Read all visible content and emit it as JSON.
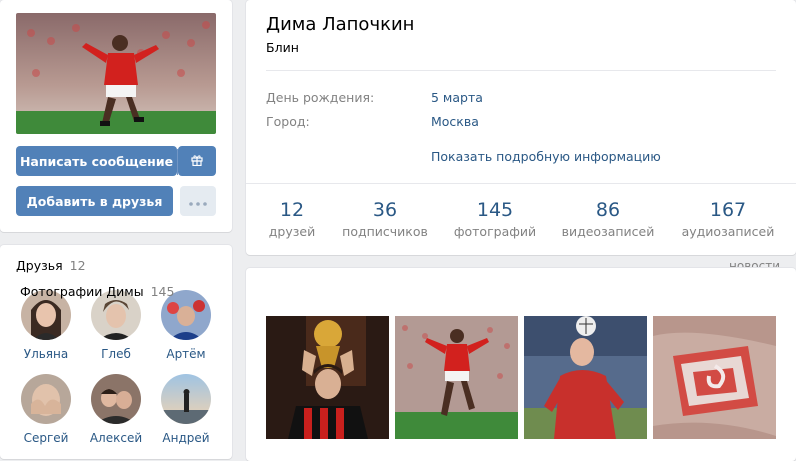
{
  "sidebar": {
    "message_button": "Написать сообщение",
    "gift_icon": "gift-icon",
    "add_friend_button": "Добавить в друзья",
    "more_icon": "more-dots-icon"
  },
  "friends": {
    "title": "Друзья",
    "count": "12",
    "news_link": "новости",
    "items": [
      {
        "name": "Ульяна"
      },
      {
        "name": "Глеб"
      },
      {
        "name": "Артём"
      },
      {
        "name": "Сергей"
      },
      {
        "name": "Алексей"
      },
      {
        "name": "Андрей"
      }
    ]
  },
  "profile": {
    "name": "Дима Лапочкин",
    "status": "Блин",
    "info": [
      {
        "label": "День рождения:",
        "value": "5 марта"
      },
      {
        "label": "Город:",
        "value": "Москва"
      }
    ],
    "more_link": "Показать подробную информацию",
    "counters": [
      {
        "num": "12",
        "label": "друзей"
      },
      {
        "num": "36",
        "label": "подписчиков"
      },
      {
        "num": "145",
        "label": "фотографий"
      },
      {
        "num": "86",
        "label": "видеозаписей"
      },
      {
        "num": "167",
        "label": "аудиозаписей"
      }
    ]
  },
  "photos": {
    "title": "Фотографии Димы",
    "count": "145"
  },
  "colors": {
    "accent": "#5181b8",
    "link": "#2a5885",
    "muted": "#828282",
    "background": "#edeef0"
  }
}
